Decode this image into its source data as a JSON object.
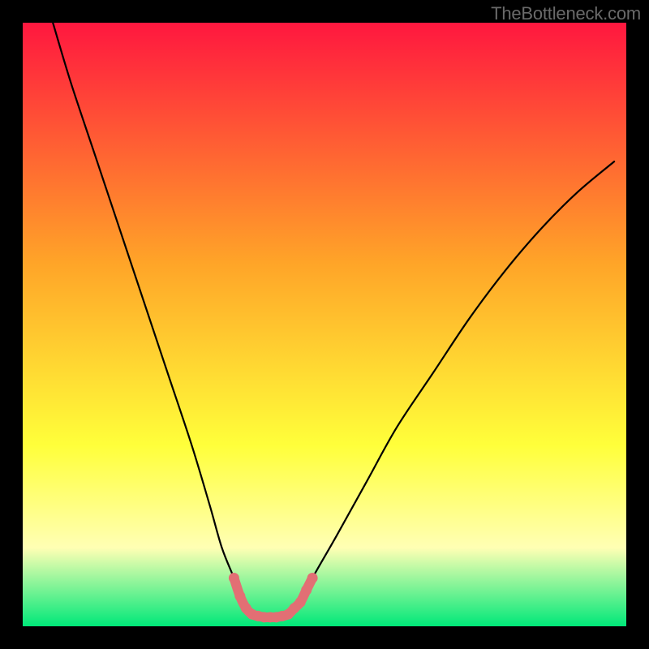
{
  "watermark": "TheBottleneck.com",
  "colors": {
    "frame": "#000000",
    "gradient_top": "#ff173f",
    "gradient_mid": "#ffa528",
    "gradient_low": "#ffff3a",
    "gradient_pale": "#ffffb4",
    "gradient_bottom": "#00e879",
    "curve": "#000000",
    "highlight": "#e26f74"
  },
  "chart_data": {
    "type": "line",
    "title": "",
    "xlabel": "",
    "ylabel": "",
    "xlim": [
      0,
      100
    ],
    "ylim": [
      0,
      100
    ],
    "series": [
      {
        "name": "bottleneck-curve",
        "x": [
          5,
          8,
          12,
          16,
          20,
          24,
          28,
          31,
          33,
          35,
          36.5,
          38,
          40,
          42,
          44,
          46,
          48,
          52,
          57,
          62,
          68,
          74,
          80,
          86,
          92,
          98
        ],
        "y": [
          100,
          90,
          78,
          66,
          54,
          42,
          30,
          20,
          13,
          8,
          4,
          2,
          1.5,
          1.5,
          2,
          4,
          8,
          15,
          24,
          33,
          42,
          51,
          59,
          66,
          72,
          77
        ]
      },
      {
        "name": "minimum-valley-highlight",
        "x": [
          35,
          36,
          37,
          38,
          39,
          40,
          41,
          42,
          43,
          44,
          45,
          46,
          47,
          48
        ],
        "y": [
          8,
          5,
          3,
          2,
          1.7,
          1.5,
          1.5,
          1.5,
          1.7,
          2,
          3,
          4,
          6,
          8
        ]
      }
    ],
    "annotations": []
  }
}
